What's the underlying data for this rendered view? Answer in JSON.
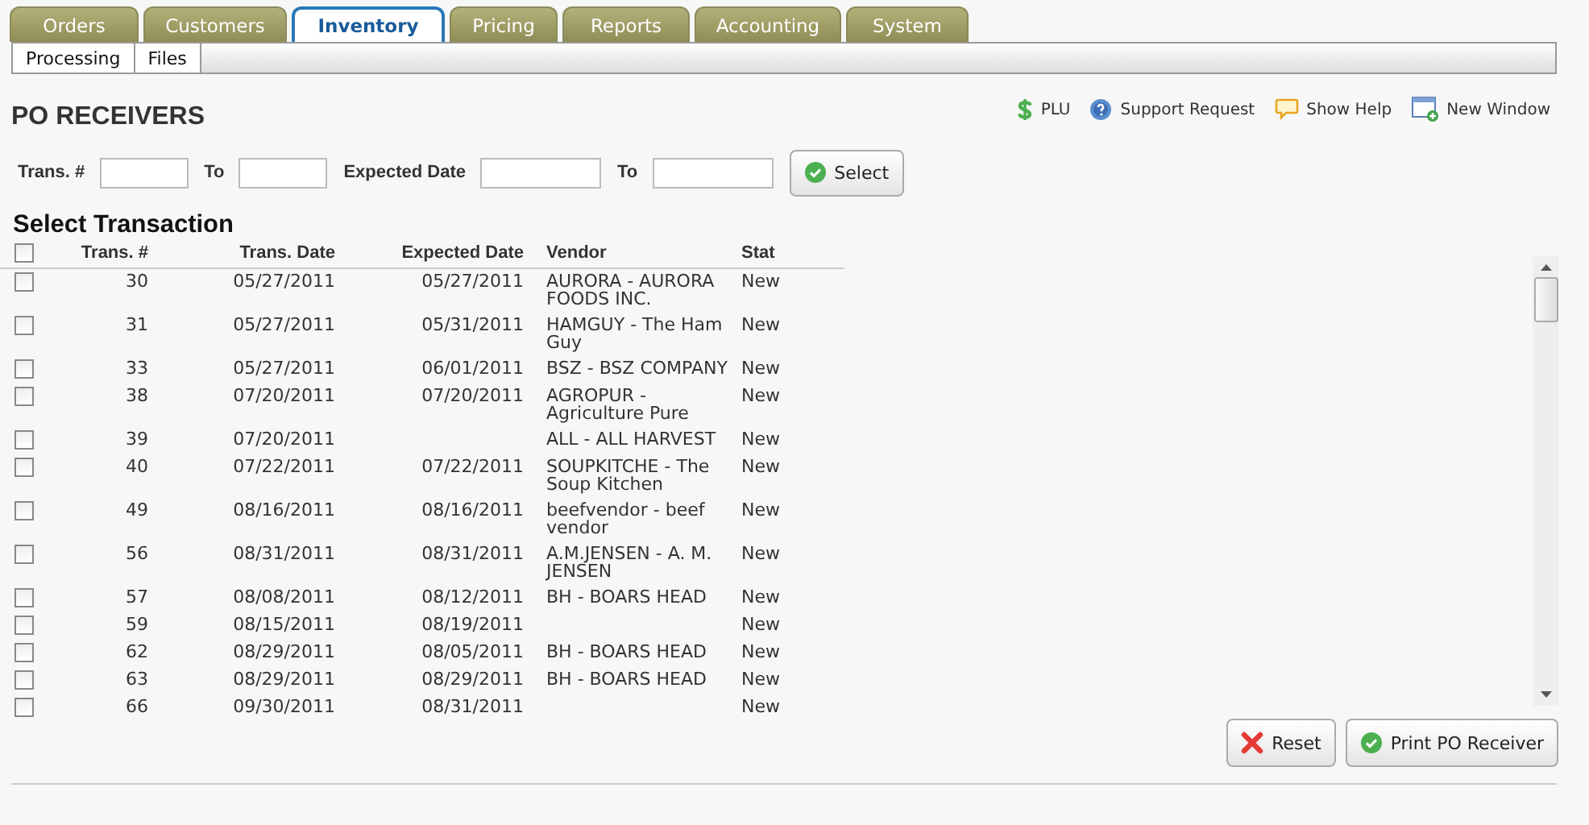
{
  "tabs": [
    {
      "label": "Orders",
      "selected": false
    },
    {
      "label": "Customers",
      "selected": false
    },
    {
      "label": "Inventory",
      "selected": true
    },
    {
      "label": "Pricing",
      "selected": false
    },
    {
      "label": "Reports",
      "selected": false
    },
    {
      "label": "Accounting",
      "selected": false
    },
    {
      "label": "System",
      "selected": false
    }
  ],
  "subtabs": [
    "Processing",
    "Files"
  ],
  "page_title": "PO RECEIVERS",
  "toolbar_links": [
    {
      "kind": "dollar",
      "label": "PLU"
    },
    {
      "kind": "help",
      "label": "Support Request"
    },
    {
      "kind": "bubble",
      "label": "Show Help"
    },
    {
      "kind": "window",
      "label": "New Window"
    }
  ],
  "filters": {
    "trans_label": "Trans. #",
    "to_label_1": "To",
    "date_label": "Expected Date",
    "to_label_2": "To",
    "select_button": "Select"
  },
  "section_title": "Select Transaction",
  "table": {
    "select_all_checked": false,
    "columns": [
      "Trans. #",
      "Trans. Date",
      "Expected Date",
      "Vendor",
      "Stat"
    ],
    "rows": [
      {
        "checked": false,
        "cells": [
          "30",
          "05/27/2011",
          "05/27/2011",
          "AURORA - AURORA FOODS INC.",
          "New"
        ]
      },
      {
        "checked": false,
        "cells": [
          "31",
          "05/27/2011",
          "05/31/2011",
          "HAMGUY - The Ham Guy",
          "New"
        ]
      },
      {
        "checked": false,
        "cells": [
          "33",
          "05/27/2011",
          "06/01/2011",
          "BSZ - BSZ COMPANY",
          "New"
        ]
      },
      {
        "checked": false,
        "cells": [
          "38",
          "07/20/2011",
          "07/20/2011",
          "AGROPUR - Agriculture Pure",
          "New"
        ]
      },
      {
        "checked": false,
        "cells": [
          "39",
          "07/20/2011",
          "",
          "ALL - ALL HARVEST",
          "New"
        ]
      },
      {
        "checked": false,
        "cells": [
          "40",
          "07/22/2011",
          "07/22/2011",
          "SOUPKITCHE - The Soup Kitchen",
          "New"
        ]
      },
      {
        "checked": false,
        "cells": [
          "49",
          "08/16/2011",
          "08/16/2011",
          "beefvendor - beef vendor",
          "New"
        ]
      },
      {
        "checked": false,
        "cells": [
          "56",
          "08/31/2011",
          "08/31/2011",
          "A.M.JENSEN - A. M. JENSEN",
          "New"
        ]
      },
      {
        "checked": false,
        "cells": [
          "57",
          "08/08/2011",
          "08/12/2011",
          "BH - BOARS HEAD",
          "New"
        ]
      },
      {
        "checked": false,
        "cells": [
          "59",
          "08/15/2011",
          "08/19/2011",
          "",
          "New"
        ]
      },
      {
        "checked": false,
        "cells": [
          "62",
          "08/29/2011",
          "08/05/2011",
          "BH - BOARS HEAD",
          "New"
        ]
      },
      {
        "checked": false,
        "cells": [
          "63",
          "08/29/2011",
          "08/29/2011",
          "BH - BOARS HEAD",
          "New"
        ]
      },
      {
        "checked": false,
        "cells": [
          "66",
          "09/30/2011",
          "08/31/2011",
          "",
          "New"
        ]
      }
    ]
  },
  "buttons": [
    {
      "kind": "reset",
      "label": "Reset"
    },
    {
      "kind": "ok",
      "label": "Print PO Receiver"
    }
  ]
}
